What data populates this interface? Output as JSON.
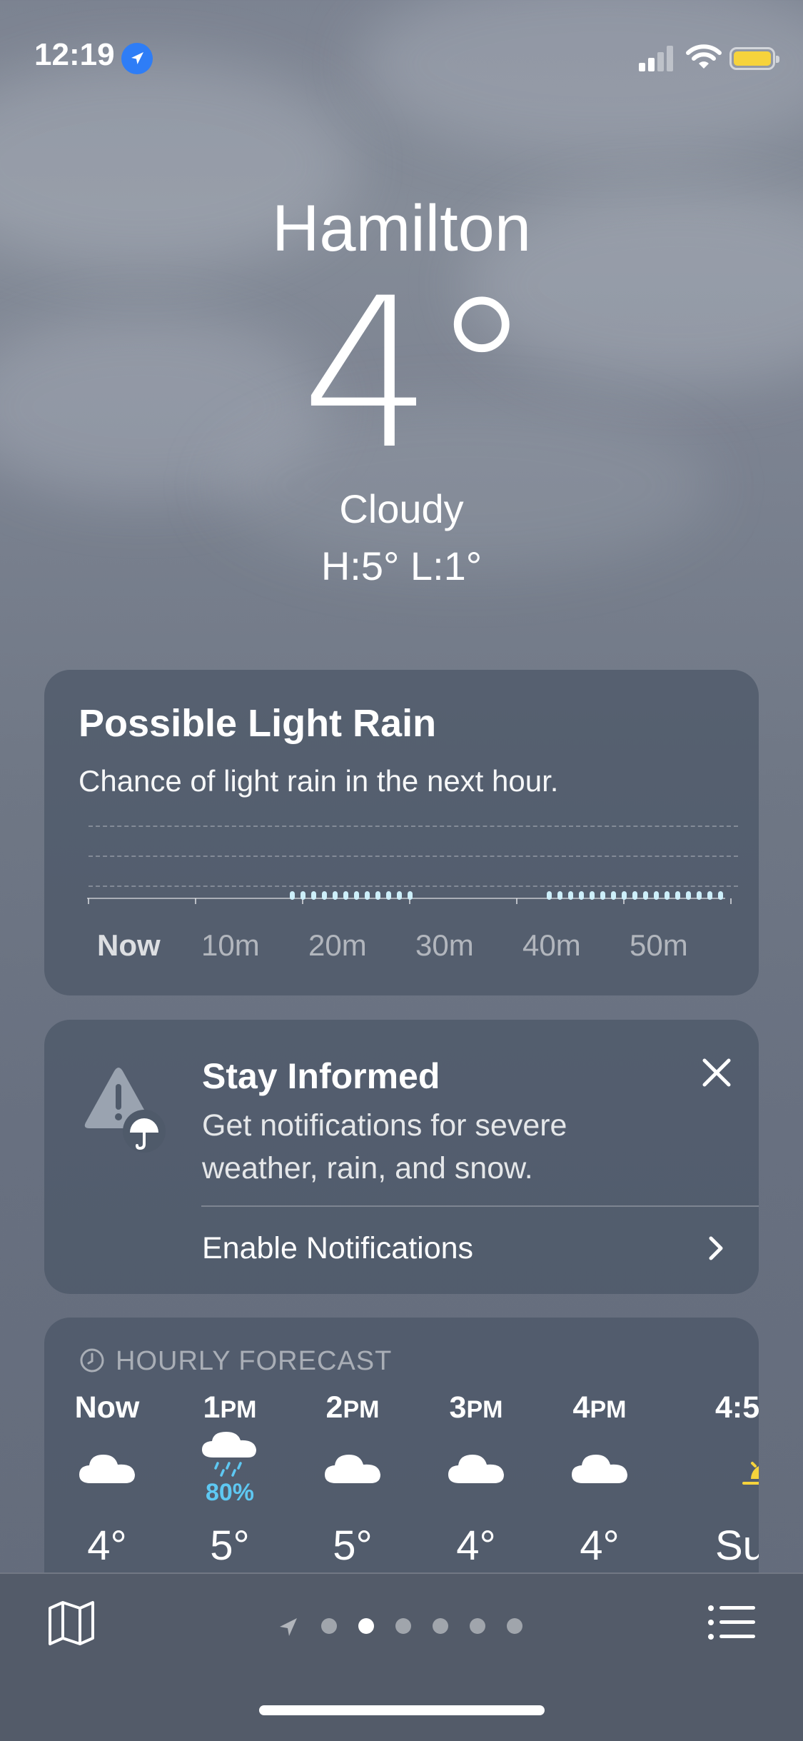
{
  "status": {
    "time": "12:19"
  },
  "hero": {
    "city": "Hamilton",
    "temp": "4°",
    "condition": "Cloudy",
    "high_low": "H:5°  L:1°"
  },
  "rain": {
    "title": "Possible Light Rain",
    "subtitle": "Chance of light rain in the next hour.",
    "axis": [
      "Now",
      "10m",
      "20m",
      "30m",
      "40m",
      "50m"
    ],
    "minutes_with_rain": [
      19,
      20,
      21,
      22,
      23,
      24,
      25,
      26,
      27,
      28,
      29,
      30,
      43,
      44,
      45,
      46,
      47,
      48,
      49,
      50,
      51,
      52,
      53,
      54,
      55,
      56,
      57,
      58,
      59
    ]
  },
  "notification": {
    "title": "Stay Informed",
    "text": "Get notifications for severe weather, rain, and snow.",
    "action": "Enable Notifications"
  },
  "hourly": {
    "label": "HOURLY FORECAST",
    "items": [
      {
        "time": "Now",
        "suffix": "",
        "icon": "cloud-icon",
        "pct": "",
        "temp": "4°"
      },
      {
        "time": "1",
        "suffix": "PM",
        "icon": "rain-cloud-icon",
        "pct": "80%",
        "temp": "5°"
      },
      {
        "time": "2",
        "suffix": "PM",
        "icon": "cloud-icon",
        "pct": "",
        "temp": "5°"
      },
      {
        "time": "3",
        "suffix": "PM",
        "icon": "cloud-icon",
        "pct": "",
        "temp": "4°"
      },
      {
        "time": "4",
        "suffix": "PM",
        "icon": "cloud-icon",
        "pct": "",
        "temp": "4°"
      },
      {
        "time": "4:5",
        "suffix": "",
        "icon": "sunset-icon",
        "pct": "",
        "temp": "Sur"
      }
    ]
  },
  "pager": {
    "pages": 6,
    "active": 1
  }
}
